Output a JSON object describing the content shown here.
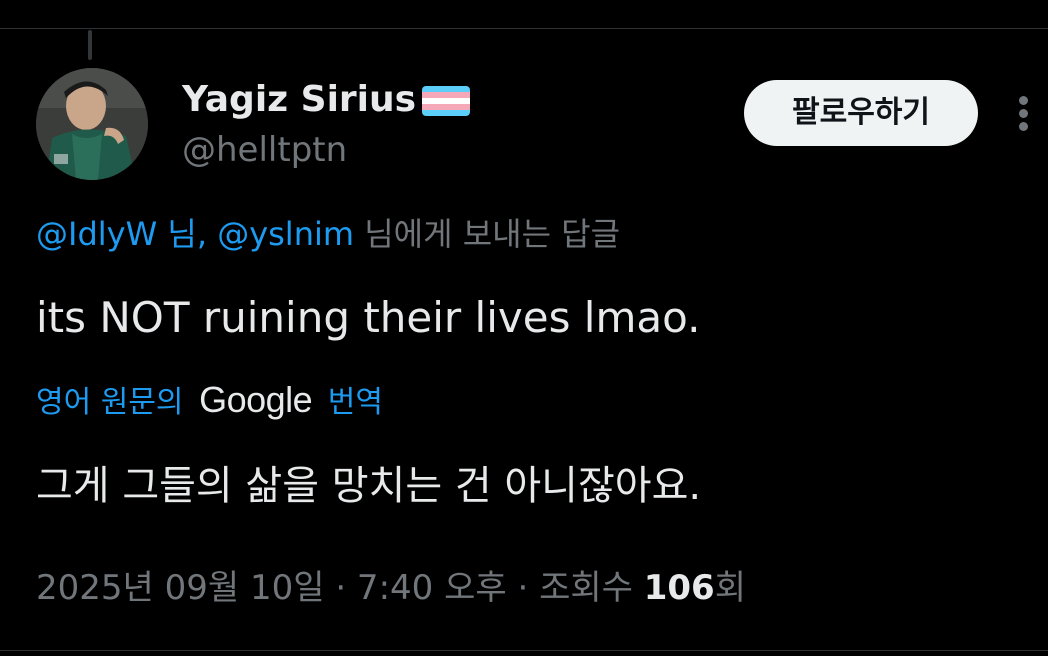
{
  "author": {
    "display_name": "Yagiz Sirius",
    "handle": "@helltptn",
    "flag_icon": "transgender-flag-icon",
    "flag_colors": [
      "#5BCEFA",
      "#F5A9B8",
      "#FFFFFF",
      "#F5A9B8",
      "#5BCEFA"
    ]
  },
  "actions": {
    "follow_label": "팔로우하기",
    "more_icon": "more-options-icon"
  },
  "reply_context": {
    "mention_1": "@IdlyW 님,",
    "mention_2": "@yslnim",
    "suffix": "님에게 보내는 답글"
  },
  "tweet": {
    "text": "its NOT ruining their lives lmao."
  },
  "translation": {
    "prefix": "영어 원문의",
    "provider": "Google",
    "suffix": "번역",
    "translated_text": "그게 그들의 삶을 망치는 건 아니잖아요."
  },
  "meta": {
    "timestamp": "2025년 09월 10일 · 7:40 오후 · 조회수",
    "views": "106",
    "views_suffix": "회"
  },
  "colors": {
    "background": "#000000",
    "text_primary": "#e7e9ea",
    "text_secondary": "#71767b",
    "accent": "#1d9bf0",
    "button_bg": "#eff3f4"
  }
}
